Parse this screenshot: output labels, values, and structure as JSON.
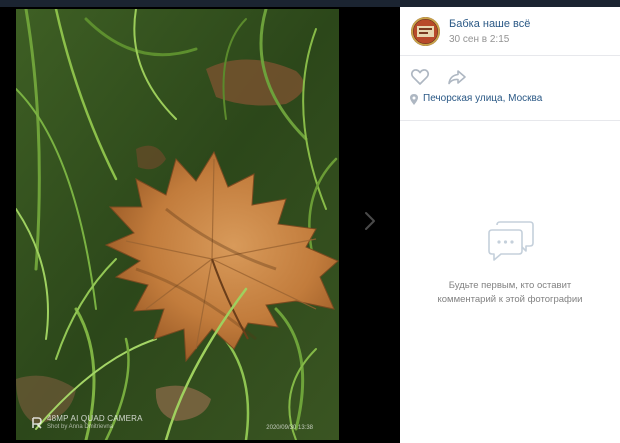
{
  "photo": {
    "watermark_line1": "48MP AI QUAD CAMERA",
    "watermark_line2": "Shot by Anna Dmitrievna",
    "timestamp": "2020/09/30 13:38"
  },
  "post": {
    "author_name": "Бабка наше всё",
    "date": "30 сен в 2:15",
    "location": "Печорская улица, Москва"
  },
  "comments": {
    "empty_line1": "Будьте первым, кто оставит",
    "empty_line2": "комментарий к этой фотографии"
  },
  "colors": {
    "link": "#2a5885",
    "muted_text": "#828282",
    "icon": "#aeb7c2",
    "background": "#000000"
  },
  "icons": {
    "like": "heart-icon",
    "share": "share-arrow-icon",
    "location": "location-pin-icon",
    "comments": "comments-bubble-icon",
    "next": "chevron-right-icon"
  }
}
